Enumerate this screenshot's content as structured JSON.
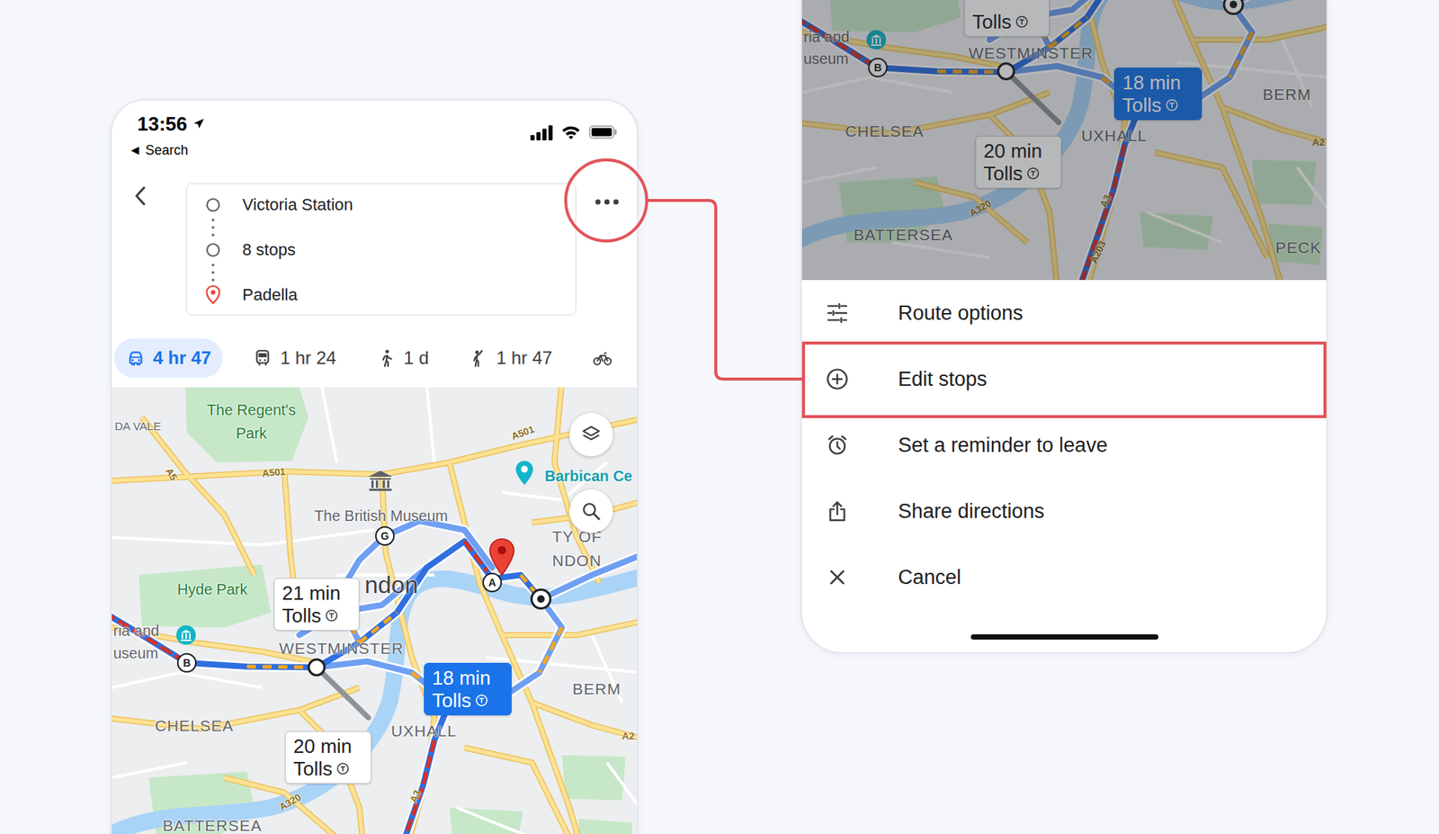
{
  "left_phone": {
    "status_bar": {
      "time": "13:56",
      "back_label": "◄ Search"
    },
    "route": {
      "stops": [
        {
          "label": "Victoria Station",
          "kind": "origin"
        },
        {
          "label": "8 stops",
          "kind": "stops"
        },
        {
          "label": "Padella",
          "kind": "destination"
        }
      ]
    },
    "more_button": {
      "highlighted": true
    },
    "modes": [
      {
        "kind": "car",
        "label": "4 hr 47",
        "selected": true
      },
      {
        "kind": "transit",
        "label": "1 hr 24",
        "selected": false
      },
      {
        "kind": "walk",
        "label": "1 d",
        "selected": false
      },
      {
        "kind": "ride",
        "label": "1 hr 47",
        "selected": false
      },
      {
        "kind": "bike",
        "selected": false
      }
    ],
    "map": {
      "labels": [
        {
          "text": "The Regent's",
          "kind": "park"
        },
        {
          "text": "Park",
          "kind": "park"
        },
        {
          "text": "DA VALE",
          "kind": "area"
        },
        {
          "text": "A5",
          "kind": "road"
        },
        {
          "text": "A501",
          "kind": "road"
        },
        {
          "text": "A501",
          "kind": "road"
        },
        {
          "text": "The British Museum",
          "kind": "poi"
        },
        {
          "text": "Barbican Ce",
          "kind": "venue"
        },
        {
          "text": "TY OF",
          "kind": "district"
        },
        {
          "text": "NDON",
          "kind": "district"
        },
        {
          "text": "Hyde Park",
          "kind": "park"
        },
        {
          "text": "ndon",
          "kind": "city"
        },
        {
          "text": "ria and",
          "kind": "poi"
        },
        {
          "text": "useum",
          "kind": "poi"
        },
        {
          "text": "WESTMINSTER",
          "kind": "district"
        },
        {
          "text": "BERM",
          "kind": "district"
        },
        {
          "text": "CHELSEA",
          "kind": "district"
        },
        {
          "text": "UXHALL",
          "kind": "district"
        },
        {
          "text": "A3",
          "kind": "road"
        },
        {
          "text": "A320",
          "kind": "road"
        },
        {
          "text": "A2",
          "kind": "road"
        },
        {
          "text": "BATTERSEA",
          "kind": "district"
        }
      ],
      "badges": [
        {
          "lines": [
            "21 min",
            "Tolls"
          ],
          "selected": false
        },
        {
          "lines": [
            "18 min",
            "Tolls"
          ],
          "selected": true
        },
        {
          "lines": [
            "20 min",
            "Tolls"
          ],
          "selected": false
        }
      ],
      "markers": [
        {
          "kind": "letter",
          "label": "G"
        },
        {
          "kind": "letter",
          "label": "A"
        },
        {
          "kind": "letter",
          "label": "B"
        },
        {
          "kind": "waypoint"
        },
        {
          "kind": "end"
        },
        {
          "kind": "pin"
        }
      ]
    }
  },
  "right_phone": {
    "map": {
      "dimmed": true,
      "labels": [
        {
          "text": "ria and",
          "kind": "poi"
        },
        {
          "text": "useum",
          "kind": "poi"
        },
        {
          "text": "WESTMINSTER",
          "kind": "district"
        },
        {
          "text": "BERM",
          "kind": "district"
        },
        {
          "text": "CHELSEA",
          "kind": "district"
        },
        {
          "text": "UXHALL",
          "kind": "district"
        },
        {
          "text": "A2",
          "kind": "road"
        },
        {
          "text": "A3",
          "kind": "road"
        },
        {
          "text": "A320",
          "kind": "road"
        },
        {
          "text": "BATTERSEA",
          "kind": "district"
        },
        {
          "text": "A203",
          "kind": "road"
        },
        {
          "text": "PECK",
          "kind": "district"
        }
      ],
      "badges": [
        {
          "lines": [
            "Tolls"
          ],
          "selected": false
        },
        {
          "lines": [
            "18 min",
            "Tolls"
          ],
          "selected": true
        },
        {
          "lines": [
            "20 min",
            "Tolls"
          ],
          "selected": false
        }
      ],
      "markers": [
        {
          "kind": "letter",
          "label": "B"
        },
        {
          "kind": "waypoint"
        },
        {
          "kind": "end"
        }
      ]
    },
    "menu": [
      {
        "label": "Route options",
        "kind": "options",
        "highlighted": false
      },
      {
        "label": "Edit stops",
        "kind": "add",
        "highlighted": true
      },
      {
        "label": "Set a reminder to leave",
        "kind": "alarm",
        "highlighted": false
      },
      {
        "label": "Share directions",
        "kind": "share",
        "highlighted": false
      },
      {
        "label": "Cancel",
        "kind": "cancel",
        "highlighted": false
      }
    ]
  }
}
